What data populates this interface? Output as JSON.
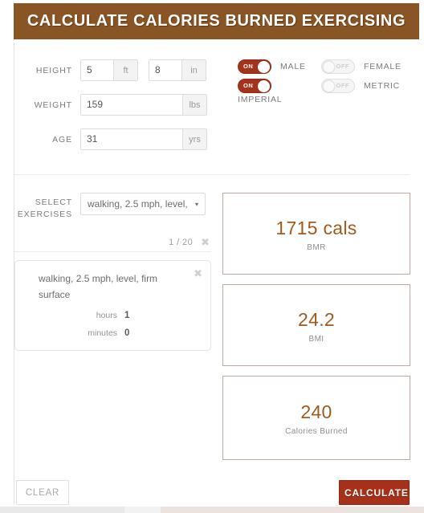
{
  "header": {
    "title": "CALCULATE CALORIES BURNED EXERCISING",
    "bg_color": "#8a5524"
  },
  "form": {
    "height": {
      "label": "HEIGHT",
      "feet_value": "5",
      "feet_unit": "ft",
      "inches_value": "8",
      "inches_unit": "in"
    },
    "weight": {
      "label": "WEIGHT",
      "value": "159",
      "unit": "lbs"
    },
    "age": {
      "label": "AGE",
      "value": "31",
      "unit": "yrs"
    }
  },
  "toggles": {
    "on_color": "#a5331c",
    "male": {
      "label": "MALE",
      "state": "ON",
      "on": true
    },
    "female": {
      "label": "FEMALE",
      "state": "OFF",
      "on": false
    },
    "imperial": {
      "label": "IMPERIAL",
      "state": "ON",
      "on": true
    },
    "metric": {
      "label": "METRIC",
      "state": "OFF",
      "on": false
    }
  },
  "exercises": {
    "select_label_line1": "SELECT",
    "select_label_line2": "EXERCISES",
    "selected_option": "walking, 2.5 mph, level,",
    "caret_icon": "▾",
    "counter": "1 / 20",
    "remove_icon": "✖",
    "card": {
      "title": "walking, 2.5 mph, level, firm surface",
      "hours_label": "hours",
      "hours_value": "1",
      "minutes_label": "minutes",
      "minutes_value": "0",
      "remove_icon": "✖"
    }
  },
  "results": [
    {
      "value": "1715 cals",
      "label": "BMR"
    },
    {
      "value": "24.2",
      "label": "BMI"
    },
    {
      "value": "240",
      "label": "Calories Burned"
    }
  ],
  "footer": {
    "clear_label": "CLEAR",
    "calculate_label": "CALCULATE",
    "calculate_color": "#a7301a"
  }
}
